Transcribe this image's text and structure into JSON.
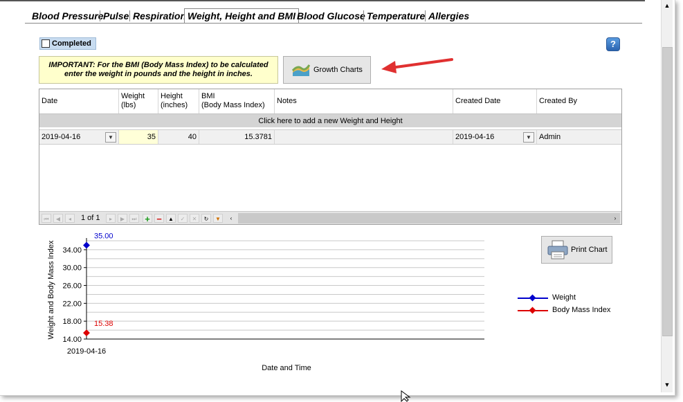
{
  "tabs": [
    {
      "label": "Blood Pressure",
      "active": false
    },
    {
      "label": "Pulse",
      "active": false
    },
    {
      "label": "Respiration",
      "active": false
    },
    {
      "label": "Weight, Height and BMI",
      "active": true
    },
    {
      "label": "Blood Glucose",
      "active": false
    },
    {
      "label": "Temperature",
      "active": false
    },
    {
      "label": "Allergies",
      "active": false
    }
  ],
  "completed": {
    "label": "Completed",
    "checked": false
  },
  "help_icon": "question-mark",
  "notice": {
    "line1": "IMPORTANT: For the BMI (Body Mass Index) to be calculated",
    "line2": "enter the weight in pounds and the height in inches."
  },
  "growth_charts": {
    "label": "Growth Charts",
    "icon": "growth-chart-icon"
  },
  "grid": {
    "columns": [
      {
        "key": "date",
        "label": "Date"
      },
      {
        "key": "weight",
        "label": "Weight (lbs)",
        "line1": "Weight",
        "line2": "(lbs)"
      },
      {
        "key": "height",
        "label": "Height (inches)",
        "line1": "Height",
        "line2": "(inches)"
      },
      {
        "key": "bmi",
        "label": "BMI (Body Mass Index)",
        "line1": "BMI",
        "line2": "(Body Mass Index)"
      },
      {
        "key": "notes",
        "label": "Notes"
      },
      {
        "key": "created_date",
        "label": "Created Date"
      },
      {
        "key": "created_by",
        "label": "Created By"
      }
    ],
    "add_row_text": "Click here to add a new Weight and Height",
    "rows": [
      {
        "date": "2019-04-16",
        "weight": "35",
        "height": "40",
        "bmi": "15.3781",
        "notes": "",
        "created_date": "2019-04-16",
        "created_by": "Admin"
      }
    ],
    "pager": {
      "page_info": "1 of 1"
    }
  },
  "print_chart": {
    "label": "Print Chart",
    "icon": "printer-icon"
  },
  "colors": {
    "weight": "#0000cc",
    "bmi": "#dd0000",
    "accent": "#2a64b0"
  },
  "chart_data": {
    "type": "line",
    "x": [
      "2019-04-16"
    ],
    "series": [
      {
        "name": "Weight",
        "values": [
          35.0
        ],
        "label": "35.00"
      },
      {
        "name": "Body Mass Index",
        "values": [
          15.38
        ],
        "label": "15.38"
      }
    ],
    "ylabel": "Weight and Body Mass Index",
    "xlabel": "Date and Time",
    "ylim": [
      14.0,
      36.0
    ],
    "yticks": [
      "14.00",
      "18.00",
      "22.00",
      "26.00",
      "30.00",
      "34.00"
    ],
    "ytick_values": [
      14,
      18,
      22,
      26,
      30,
      34
    ],
    "grid": true,
    "legend": "right"
  }
}
